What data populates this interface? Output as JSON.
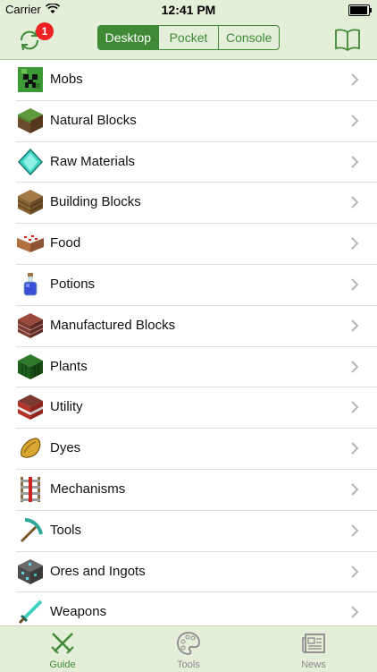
{
  "status": {
    "carrier": "Carrier",
    "time": "12:41 PM"
  },
  "navbar": {
    "badge": "1",
    "segments": [
      "Desktop",
      "Pocket",
      "Console"
    ],
    "selected_segment": "Desktop"
  },
  "categories": [
    {
      "label": "Mobs",
      "icon": "creeper-head-icon"
    },
    {
      "label": "Natural Blocks",
      "icon": "grass-block-icon"
    },
    {
      "label": "Raw Materials",
      "icon": "diamond-icon"
    },
    {
      "label": "Building Blocks",
      "icon": "wood-planks-icon"
    },
    {
      "label": "Food",
      "icon": "cake-icon"
    },
    {
      "label": "Potions",
      "icon": "potion-bottle-icon"
    },
    {
      "label": "Manufactured Blocks",
      "icon": "bricks-icon"
    },
    {
      "label": "Plants",
      "icon": "cactus-icon"
    },
    {
      "label": "Utility",
      "icon": "tnt-icon"
    },
    {
      "label": "Dyes",
      "icon": "cocoa-beans-icon"
    },
    {
      "label": "Mechanisms",
      "icon": "powered-rail-icon"
    },
    {
      "label": "Tools",
      "icon": "pickaxe-icon"
    },
    {
      "label": "Ores and Ingots",
      "icon": "ore-block-icon"
    },
    {
      "label": "Weapons",
      "icon": "diamond-sword-icon"
    }
  ],
  "tabbar": {
    "tabs": [
      {
        "label": "Guide",
        "icon": "crossed-swords-icon"
      },
      {
        "label": "Tools",
        "icon": "palette-icon"
      },
      {
        "label": "News",
        "icon": "newspaper-icon"
      }
    ],
    "active": "Guide"
  },
  "colors": {
    "accent": "#3f8a34",
    "bar_background": "#e3efd8",
    "badge": "#e22222"
  }
}
